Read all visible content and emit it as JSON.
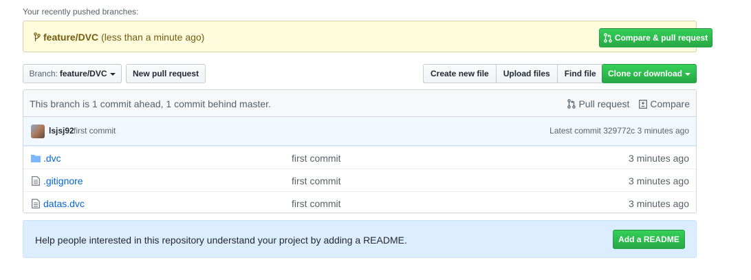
{
  "recent": {
    "label": "Your recently pushed branches:",
    "branch": "feature/DVC",
    "time": "(less than a minute ago)",
    "compare_label": "Compare & pull request"
  },
  "toolbar": {
    "branch_label": "Branch:",
    "branch_value": "feature/DVC",
    "new_pr_label": "New pull request",
    "create_file_label": "Create new file",
    "upload_label": "Upload files",
    "find_label": "Find file",
    "clone_label": "Clone or download"
  },
  "status": {
    "ahead_text": "This branch is 1 commit ahead, 1 commit behind master.",
    "pull_request_link": "Pull request",
    "compare_link": "Compare"
  },
  "commit": {
    "author": "lsjsj92",
    "message": "first commit",
    "latest_label": "Latest commit",
    "sha": "329772c",
    "age": "3 minutes ago"
  },
  "files": [
    {
      "name": ".dvc",
      "type": "folder",
      "message": "first commit",
      "age": "3 minutes ago"
    },
    {
      "name": ".gitignore",
      "type": "file",
      "message": "first commit",
      "age": "3 minutes ago"
    },
    {
      "name": "datas.dvc",
      "type": "file",
      "message": "first commit",
      "age": "3 minutes ago"
    }
  ],
  "readme": {
    "text": "Help people interested in this repository understand your project by adding a README.",
    "button_label": "Add a README"
  },
  "colors": {
    "green": "#28a745",
    "link": "#0366d6",
    "recent_bg": "#fffbdd",
    "readme_bg": "#dbedff"
  }
}
